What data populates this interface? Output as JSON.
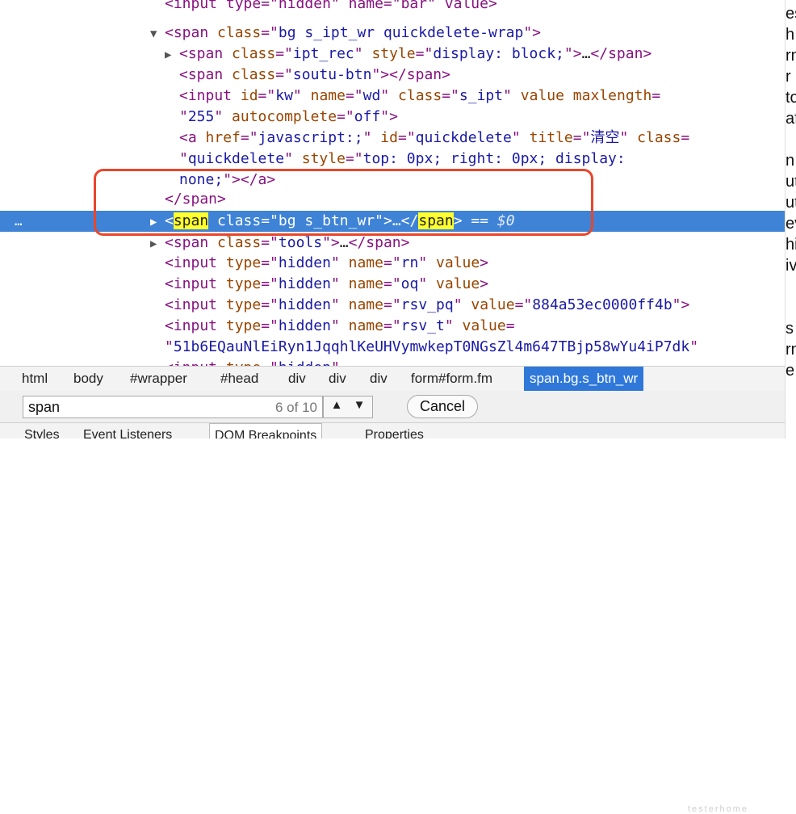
{
  "code_lines": [
    {
      "indent": 0,
      "toggle": "none",
      "parts": [
        {
          "t": "<input type=\"hidden\" name=\"bar\" value>",
          "c": "tag"
        }
      ]
    },
    {
      "indent": 0,
      "toggle": "▼",
      "parts": [
        {
          "t": "<span ",
          "c": "tag"
        },
        {
          "t": "class",
          "c": "attr"
        },
        {
          "t": "=\"",
          "c": "tag"
        },
        {
          "t": "bg s_ipt_wr quickdelete-wrap",
          "c": "val"
        },
        {
          "t": "\">",
          "c": "tag"
        }
      ]
    },
    {
      "indent": 1,
      "toggle": "▶",
      "parts": [
        {
          "t": "<span ",
          "c": "tag"
        },
        {
          "t": "class",
          "c": "attr"
        },
        {
          "t": "=\"",
          "c": "tag"
        },
        {
          "t": "ipt_rec",
          "c": "val"
        },
        {
          "t": "\" ",
          "c": "tag"
        },
        {
          "t": "style",
          "c": "attr"
        },
        {
          "t": "=\"",
          "c": "tag"
        },
        {
          "t": "display: block;",
          "c": "val"
        },
        {
          "t": "\">",
          "c": "tag"
        },
        {
          "t": "…",
          "c": "plain"
        },
        {
          "t": "</span>",
          "c": "tag"
        }
      ]
    },
    {
      "indent": 1,
      "toggle": "none",
      "parts": [
        {
          "t": "<span ",
          "c": "tag"
        },
        {
          "t": "class",
          "c": "attr"
        },
        {
          "t": "=\"",
          "c": "tag"
        },
        {
          "t": "soutu-btn",
          "c": "val"
        },
        {
          "t": "\"></span>",
          "c": "tag"
        }
      ]
    },
    {
      "indent": 1,
      "toggle": "none",
      "parts": [
        {
          "t": "<input ",
          "c": "tag"
        },
        {
          "t": "id",
          "c": "attr"
        },
        {
          "t": "=\"",
          "c": "tag"
        },
        {
          "t": "kw",
          "c": "val"
        },
        {
          "t": "\" ",
          "c": "tag"
        },
        {
          "t": "name",
          "c": "attr"
        },
        {
          "t": "=\"",
          "c": "tag"
        },
        {
          "t": "wd",
          "c": "val"
        },
        {
          "t": "\" ",
          "c": "tag"
        },
        {
          "t": "class",
          "c": "attr"
        },
        {
          "t": "=\"",
          "c": "tag"
        },
        {
          "t": "s_ipt",
          "c": "val"
        },
        {
          "t": "\" ",
          "c": "tag"
        },
        {
          "t": "value maxlength",
          "c": "attr"
        },
        {
          "t": "=",
          "c": "tag"
        }
      ]
    },
    {
      "indent": 1,
      "toggle": "none",
      "parts": [
        {
          "t": "\"",
          "c": "tag"
        },
        {
          "t": "255",
          "c": "val"
        },
        {
          "t": "\" ",
          "c": "tag"
        },
        {
          "t": "autocomplete",
          "c": "attr"
        },
        {
          "t": "=\"",
          "c": "tag"
        },
        {
          "t": "off",
          "c": "val"
        },
        {
          "t": "\">",
          "c": "tag"
        }
      ]
    },
    {
      "indent": 1,
      "toggle": "none",
      "parts": [
        {
          "t": "<a ",
          "c": "tag"
        },
        {
          "t": "href",
          "c": "attr"
        },
        {
          "t": "=\"",
          "c": "tag"
        },
        {
          "t": "javascript:;",
          "c": "val"
        },
        {
          "t": "\" ",
          "c": "tag"
        },
        {
          "t": "id",
          "c": "attr"
        },
        {
          "t": "=\"",
          "c": "tag"
        },
        {
          "t": "quickdelete",
          "c": "val"
        },
        {
          "t": "\" ",
          "c": "tag"
        },
        {
          "t": "title",
          "c": "attr"
        },
        {
          "t": "=\"",
          "c": "tag"
        },
        {
          "t": "清空",
          "c": "val"
        },
        {
          "t": "\" ",
          "c": "tag"
        },
        {
          "t": "class",
          "c": "attr"
        },
        {
          "t": "=",
          "c": "tag"
        }
      ]
    },
    {
      "indent": 1,
      "toggle": "none",
      "parts": [
        {
          "t": "\"",
          "c": "tag"
        },
        {
          "t": "quickdelete",
          "c": "val"
        },
        {
          "t": "\" ",
          "c": "tag"
        },
        {
          "t": "style",
          "c": "attr"
        },
        {
          "t": "=\"",
          "c": "tag"
        },
        {
          "t": "top: 0px; right: 0px; display:",
          "c": "val"
        }
      ]
    },
    {
      "indent": 1,
      "toggle": "none",
      "parts": [
        {
          "t": "none;",
          "c": "val"
        },
        {
          "t": "\"></a>",
          "c": "tag"
        }
      ]
    },
    {
      "indent": 0,
      "toggle": "none",
      "parts": [
        {
          "t": "</span>",
          "c": "tag"
        }
      ]
    },
    {
      "indent": 0,
      "toggle": "▶",
      "selected": true,
      "parts": [
        {
          "t": "<",
          "c": "tag"
        },
        {
          "t": "span",
          "c": "tag",
          "hl": true
        },
        {
          "t": " class",
          "c": "attr"
        },
        {
          "t": "=\"",
          "c": "tag"
        },
        {
          "t": "bg s_btn_wr",
          "c": "val"
        },
        {
          "t": "\">",
          "c": "tag"
        },
        {
          "t": "…",
          "c": "plain"
        },
        {
          "t": "</",
          "c": "tag"
        },
        {
          "t": "span",
          "c": "tag",
          "hl": true
        },
        {
          "t": ">",
          "c": "tag"
        },
        {
          "t": " == ",
          "c": "plain"
        },
        {
          "t": "$0",
          "c": "dollar"
        }
      ]
    },
    {
      "indent": 0,
      "toggle": "▶",
      "parts": [
        {
          "t": "<span ",
          "c": "tag"
        },
        {
          "t": "class",
          "c": "attr"
        },
        {
          "t": "=\"",
          "c": "tag"
        },
        {
          "t": "tools",
          "c": "val"
        },
        {
          "t": "\">",
          "c": "tag"
        },
        {
          "t": "…",
          "c": "plain"
        },
        {
          "t": "</span>",
          "c": "tag"
        }
      ]
    },
    {
      "indent": 0,
      "toggle": "none",
      "parts": [
        {
          "t": "<input ",
          "c": "tag"
        },
        {
          "t": "type",
          "c": "attr"
        },
        {
          "t": "=\"",
          "c": "tag"
        },
        {
          "t": "hidden",
          "c": "val"
        },
        {
          "t": "\" ",
          "c": "tag"
        },
        {
          "t": "name",
          "c": "attr"
        },
        {
          "t": "=\"",
          "c": "tag"
        },
        {
          "t": "rn",
          "c": "val"
        },
        {
          "t": "\" ",
          "c": "tag"
        },
        {
          "t": "value",
          "c": "attr"
        },
        {
          "t": ">",
          "c": "tag"
        }
      ]
    },
    {
      "indent": 0,
      "toggle": "none",
      "parts": [
        {
          "t": "<input ",
          "c": "tag"
        },
        {
          "t": "type",
          "c": "attr"
        },
        {
          "t": "=\"",
          "c": "tag"
        },
        {
          "t": "hidden",
          "c": "val"
        },
        {
          "t": "\" ",
          "c": "tag"
        },
        {
          "t": "name",
          "c": "attr"
        },
        {
          "t": "=\"",
          "c": "tag"
        },
        {
          "t": "oq",
          "c": "val"
        },
        {
          "t": "\" ",
          "c": "tag"
        },
        {
          "t": "value",
          "c": "attr"
        },
        {
          "t": ">",
          "c": "tag"
        }
      ]
    },
    {
      "indent": 0,
      "toggle": "none",
      "parts": [
        {
          "t": "<input ",
          "c": "tag"
        },
        {
          "t": "type",
          "c": "attr"
        },
        {
          "t": "=\"",
          "c": "tag"
        },
        {
          "t": "hidden",
          "c": "val"
        },
        {
          "t": "\" ",
          "c": "tag"
        },
        {
          "t": "name",
          "c": "attr"
        },
        {
          "t": "=\"",
          "c": "tag"
        },
        {
          "t": "rsv_pq",
          "c": "val"
        },
        {
          "t": "\" ",
          "c": "tag"
        },
        {
          "t": "value",
          "c": "attr"
        },
        {
          "t": "=\"",
          "c": "tag"
        },
        {
          "t": "884a53ec0000ff4b",
          "c": "val"
        },
        {
          "t": "\">",
          "c": "tag"
        }
      ]
    },
    {
      "indent": 0,
      "toggle": "none",
      "parts": [
        {
          "t": "<input ",
          "c": "tag"
        },
        {
          "t": "type",
          "c": "attr"
        },
        {
          "t": "=\"",
          "c": "tag"
        },
        {
          "t": "hidden",
          "c": "val"
        },
        {
          "t": "\" ",
          "c": "tag"
        },
        {
          "t": "name",
          "c": "attr"
        },
        {
          "t": "=\"",
          "c": "tag"
        },
        {
          "t": "rsv_t",
          "c": "val"
        },
        {
          "t": "\" ",
          "c": "tag"
        },
        {
          "t": "value",
          "c": "attr"
        },
        {
          "t": "=",
          "c": "tag"
        }
      ]
    },
    {
      "indent": 0,
      "toggle": "none",
      "parts": [
        {
          "t": "\"",
          "c": "tag"
        },
        {
          "t": "51b6EQauNlEiRyn1JqqhlKeUHVymwkepT0NGsZl4m647TBjp58wYu4iP7dk",
          "c": "val"
        },
        {
          "t": "\"",
          "c": "tag"
        }
      ]
    },
    {
      "indent": 0,
      "toggle": "none",
      "parts": [
        {
          "t": "<input ",
          "c": "tag"
        },
        {
          "t": "type",
          "c": "attr"
        },
        {
          "t": "=\"",
          "c": "tag"
        },
        {
          "t": "hidden",
          "c": "val"
        },
        {
          "t": "\"",
          "c": "tag"
        }
      ]
    }
  ],
  "selected_row_marker": "…",
  "right_edge_glyphs": [
    "es",
    "h",
    "rn",
    "r",
    "to",
    "af",
    "",
    "n",
    "ut",
    "ut",
    "ev",
    "hi",
    "iv",
    "",
    "",
    "s",
    "rn",
    "e"
  ],
  "breadcrumb": {
    "items": [
      "html",
      "body",
      "#wrapper",
      "#head",
      "div",
      "div",
      "div",
      "form#form.fm",
      "span.bg.s_btn_wr"
    ],
    "active_index": 8
  },
  "search": {
    "query": "span",
    "count": "6 of 10",
    "prev_icon": "▲",
    "next_icon": "▼",
    "cancel_label": "Cancel"
  },
  "watermark": "testerhome",
  "subtabs": [
    "Styles",
    "Event Listeners",
    "DOM Breakpoints",
    "Properties"
  ],
  "colors": {
    "tag": "#881280",
    "attr": "#994500",
    "value": "#1a1aa6",
    "selection": "#3f83d6",
    "search_highlight": "#ffff2b",
    "annotation_box": "#e8462b",
    "breadcrumb_active": "#2f78d9"
  }
}
